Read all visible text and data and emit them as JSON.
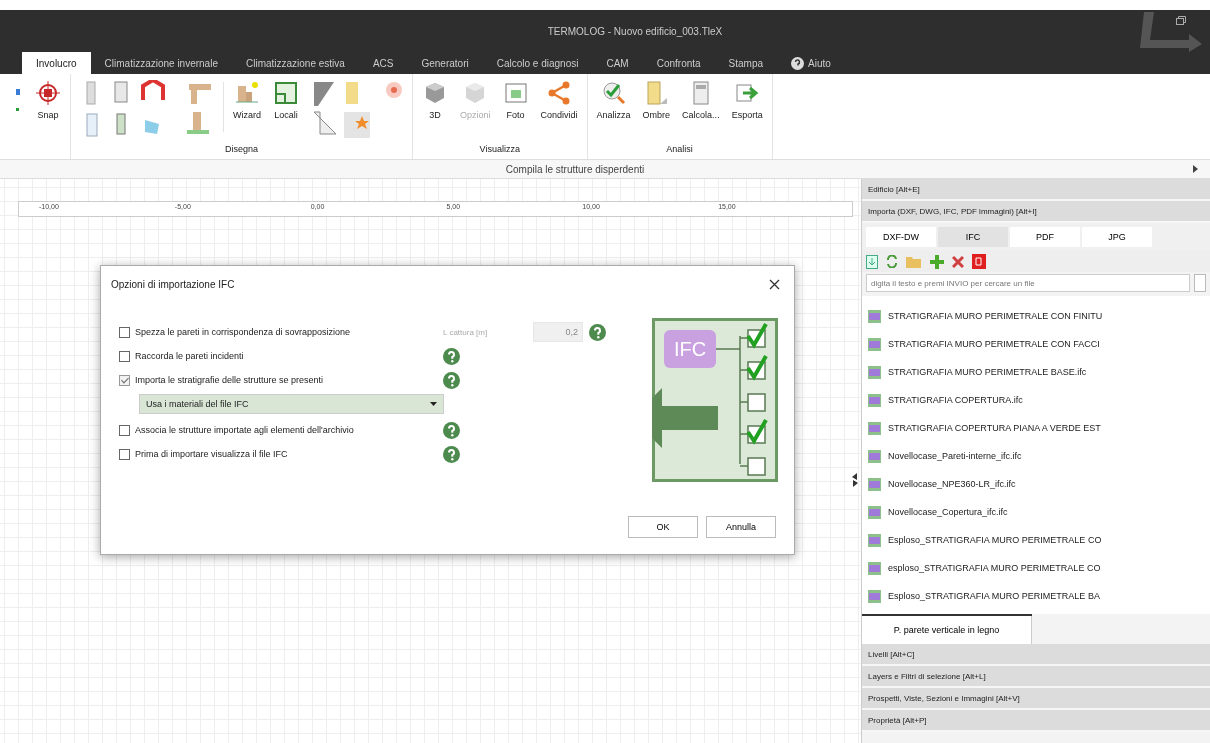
{
  "window": {
    "title": "TERMOLOG - Nuovo edificio_003.TleX"
  },
  "tabs": [
    {
      "label": "Involucro",
      "selected": true,
      "kind": "text"
    },
    {
      "label": "Climatizzazione invernale",
      "selected": false,
      "kind": "text"
    },
    {
      "label": "Climatizzazione estiva",
      "selected": false,
      "kind": "text"
    },
    {
      "label": "ACS",
      "selected": false,
      "kind": "text"
    },
    {
      "label": "Generatori",
      "selected": false,
      "kind": "text"
    },
    {
      "label": "Calcolo e diagnosi",
      "selected": false,
      "kind": "text"
    },
    {
      "label": "CAM",
      "selected": false,
      "kind": "text"
    },
    {
      "label": "Confronta",
      "selected": false,
      "kind": "text"
    },
    {
      "label": "Stampa",
      "selected": false,
      "kind": "text"
    },
    {
      "label": "Aiuto",
      "selected": false,
      "kind": "help"
    }
  ],
  "ribbon": {
    "groups": [
      {
        "items": [
          {
            "label": "Snap",
            "kind": "snap",
            "disabled": false
          }
        ]
      },
      {
        "label": "Disegna",
        "items": [
          {
            "kind": "walls"
          },
          {
            "kind": "roof"
          },
          {
            "kind": "beams"
          },
          {
            "label": "Wizard",
            "kind": "wizard",
            "disabled": false
          },
          {
            "label": "Locali",
            "kind": "rooms",
            "disabled": false
          },
          {
            "kind": "profiles"
          },
          {
            "kind": "marker"
          }
        ]
      },
      {
        "label": "Visualizza",
        "items": [
          {
            "label": "3D",
            "kind": "cube",
            "disabled": false
          },
          {
            "label": "Opzioni",
            "kind": "cube",
            "disabled": true
          },
          {
            "label": "Foto",
            "kind": "photo",
            "disabled": false
          },
          {
            "label": "Condividi",
            "kind": "share",
            "disabled": false
          }
        ]
      },
      {
        "label": "Analisi",
        "items": [
          {
            "label": "Analizza",
            "kind": "analyze",
            "disabled": false
          },
          {
            "label": "Ombre",
            "kind": "building",
            "disabled": false
          },
          {
            "label": "Calcola...",
            "kind": "calc",
            "disabled": false
          },
          {
            "label": "Esporta",
            "kind": "export",
            "disabled": false
          }
        ]
      }
    ]
  },
  "strip": {
    "text": "Compila le strutture disperdenti"
  },
  "ruler": [
    "-10,00",
    "-5,00",
    "0,00",
    "5,00",
    "10,00",
    "15,00"
  ],
  "dialog": {
    "title": "Opzioni di importazione IFC",
    "options": [
      {
        "kind": "check",
        "label": "Spezza le pareti in corrispondenza di sovrapposizione",
        "checked": false,
        "field_label": "L cattura [m]",
        "field_value": "0,2"
      },
      {
        "kind": "check",
        "label": "Raccorda le pareti incidenti",
        "checked": false
      },
      {
        "kind": "check",
        "label": "Importa le stratigrafie delle strutture se presenti",
        "checked": true
      },
      {
        "kind": "select",
        "value": "Usa i materiali del file IFC"
      },
      {
        "kind": "check",
        "label": "Associa le strutture importate agli elementi dell'archivio",
        "checked": false
      },
      {
        "kind": "check",
        "label": "Prima di importare visualizza il file IFC",
        "checked": false
      }
    ],
    "illustration": {
      "label": "IFC",
      "checks": [
        true,
        true,
        false,
        true,
        false
      ]
    },
    "buttons": [
      "OK",
      "Annulla"
    ]
  },
  "panel": {
    "sections_top": [
      "Edificio [Alt+E]",
      "Importa (DXF, DWG, IFC, PDF immagini) [Alt+I]"
    ],
    "tabs": [
      {
        "label": "DXF-DW",
        "selected": false
      },
      {
        "label": "IFC",
        "selected": true
      },
      {
        "label": "PDF",
        "selected": false
      },
      {
        "label": "JPG",
        "selected": false
      }
    ],
    "search": {
      "placeholder": "digita il testo e premi INVIO per cercare un file"
    },
    "files": [
      "STRATIGRAFIA MURO PERIMETRALE CON FINITU",
      "STRATIGRAFIA MURO PERIMETRALE CON FACCI",
      "STRATIGRAFIA MURO PERIMETRALE BASE.ifc",
      "STRATIGRAFIA COPERTURA.ifc",
      "STRATIGRAFIA COPERTURA PIANA A VERDE EST",
      "Novellocase_Pareti-interne_ifc.ifc",
      "Novellocase_NPE360-LR_ifc.ifc",
      "Novellocase_Copertura_ifc.ifc",
      "Esploso_STRATIGRAFIA MURO PERIMETRALE CO",
      "esploso_STRATIGRAFIA MURO PERIMETRALE CO",
      "Esploso_STRATIGRAFIA MURO PERIMETRALE BA"
    ],
    "bottom_tab": "P. parete verticale in legno",
    "sections_bottom": [
      "Livelli [Alt+C]",
      "Layers e Filtri di selezione [Alt+L]",
      "Prospetti, Viste, Sezioni e Immagini [Alt+V]",
      "Proprietà [Alt+P]"
    ]
  }
}
